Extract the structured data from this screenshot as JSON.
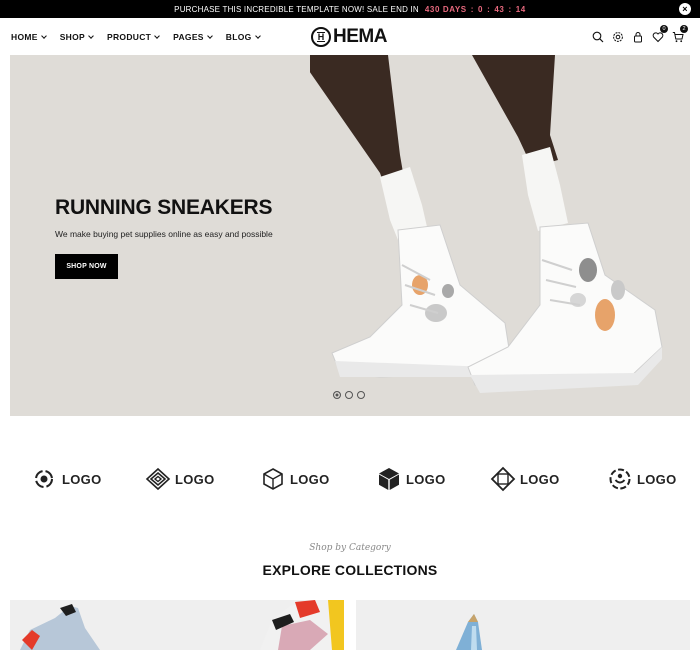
{
  "topbar": {
    "message": "PURCHASE THIS INCREDIBLE TEMPLATE NOW! SALE END IN",
    "countdown": {
      "days": "430 DAYS",
      "hours": "0",
      "minutes": "43",
      "seconds": "14"
    },
    "close_glyph": "×"
  },
  "header": {
    "nav": [
      {
        "label": "HOME"
      },
      {
        "label": "SHOP"
      },
      {
        "label": "PRODUCT"
      },
      {
        "label": "PAGES"
      },
      {
        "label": "BLOG"
      }
    ],
    "logo": {
      "mark": "H",
      "text": "HEMA"
    },
    "icons": [
      "search-icon",
      "settings-icon",
      "user-icon",
      "wishlist-icon",
      "cart-icon"
    ],
    "wishlist_count": "0",
    "cart_count": "2"
  },
  "hero": {
    "title": "RUNNING SNEAKERS",
    "subtitle": "We make buying pet supplies online as easy and possible",
    "button": "SHOP NOW",
    "slides": 3,
    "active_slide": 1
  },
  "brands": [
    {
      "icon": "logo-circle-icon",
      "label": "LOGO"
    },
    {
      "icon": "logo-diamond-icon",
      "label": "LOGO"
    },
    {
      "icon": "logo-box-outline-icon",
      "label": "LOGO"
    },
    {
      "icon": "logo-cube-icon",
      "label": "LOGO"
    },
    {
      "icon": "logo-square-icon",
      "label": "LOGO"
    },
    {
      "icon": "logo-smile-icon",
      "label": "LOGO"
    }
  ],
  "collections": {
    "subtitle": "Shop by Category",
    "title": "EXPLORE COLLECTIONS"
  },
  "colors": {
    "topbar_bg": "#000000",
    "countdown": "#e8697e",
    "hero_bg": "#dfdcd7",
    "button_bg": "#000000"
  }
}
